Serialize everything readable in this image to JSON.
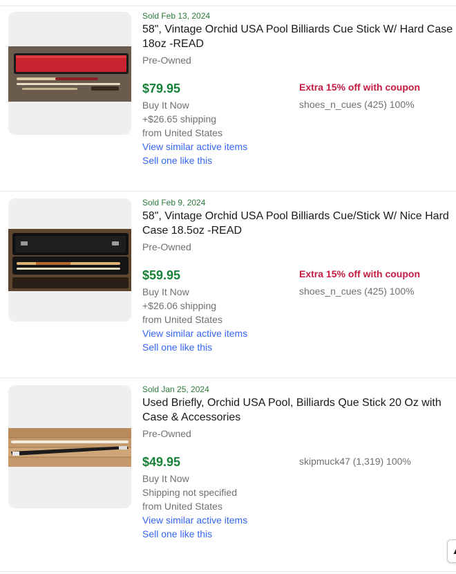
{
  "listings": [
    {
      "sold_date": "Sold Feb 13, 2024",
      "title": "58\", Vintage Orchid USA Pool Billiards Cue Stick W/ Hard Case 18oz -READ",
      "condition": "Pre-Owned",
      "price": "$79.95",
      "format": "Buy It Now",
      "shipping": "+$26.65 shipping",
      "location": "from United States",
      "coupon": "Extra 15% off with coupon",
      "seller": "shoes_n_cues (425) 100%",
      "view_similar": "View similar active items",
      "sell_one": "Sell one like this",
      "image_description": "red-case-cue-photo"
    },
    {
      "sold_date": "Sold Feb 9, 2024",
      "title": "58\", Vintage Orchid USA Pool Billiards Cue/Stick W/ Nice Hard Case 18.5oz -READ",
      "condition": "Pre-Owned",
      "price": "$59.95",
      "format": "Buy It Now",
      "shipping": "+$26.06 shipping",
      "location": "from United States",
      "coupon": "Extra 15% off with coupon",
      "seller": "shoes_n_cues (425) 100%",
      "view_similar": "View similar active items",
      "sell_one": "Sell one like this",
      "image_description": "black-case-cue-photo"
    },
    {
      "sold_date": "Sold Jan 25, 2024",
      "title": "Used Briefly, Orchid USA Pool, Billiards Que Stick 20 Oz with Case & Accessories",
      "condition": "Pre-Owned",
      "price": "$49.95",
      "format": "Buy It Now",
      "shipping": "Shipping not specified",
      "location": "from United States",
      "seller": "skipmuck47 (1,319) 100%",
      "view_similar": "View similar active items",
      "sell_one": "Sell one like this",
      "image_description": "cue-on-wood-floor-photo"
    }
  ],
  "scroll_top_icon": "arrow-up-icon",
  "colors": {
    "sold": "#2a7a3b",
    "price": "#178237",
    "coupon": "#c51b42",
    "link": "#3665f3",
    "muted": "#707070"
  }
}
